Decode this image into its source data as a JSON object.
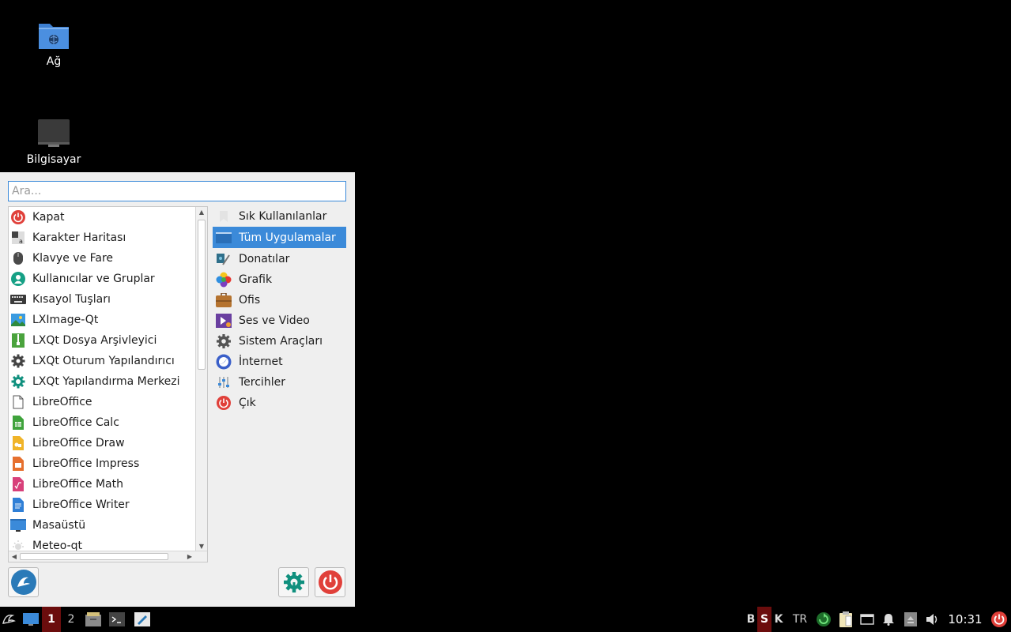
{
  "desktop": {
    "icons": [
      {
        "label": "Ağ",
        "icon": "network-folder-icon"
      },
      {
        "label": "Bilgisayar",
        "icon": "computer-icon"
      }
    ]
  },
  "menu": {
    "search_placeholder": "Ara...",
    "apps": [
      {
        "label": "Kapat",
        "icon": "power-icon"
      },
      {
        "label": "Karakter Haritası",
        "icon": "character-map-icon"
      },
      {
        "label": "Klavye ve Fare",
        "icon": "mouse-icon"
      },
      {
        "label": "Kullanıcılar ve Gruplar",
        "icon": "users-icon"
      },
      {
        "label": "Kısayol Tuşları",
        "icon": "keyboard-icon"
      },
      {
        "label": "LXImage-Qt",
        "icon": "image-viewer-icon"
      },
      {
        "label": "LXQt Dosya Arşivleyici",
        "icon": "archiver-icon"
      },
      {
        "label": "LXQt Oturum Yapılandırıcı",
        "icon": "gear-icon"
      },
      {
        "label": "LXQt Yapılandırma Merkezi",
        "icon": "config-center-icon"
      },
      {
        "label": "LibreOffice",
        "icon": "libreoffice-icon"
      },
      {
        "label": "LibreOffice Calc",
        "icon": "calc-icon"
      },
      {
        "label": "LibreOffice Draw",
        "icon": "draw-icon"
      },
      {
        "label": "LibreOffice Impress",
        "icon": "impress-icon"
      },
      {
        "label": "LibreOffice Math",
        "icon": "math-icon"
      },
      {
        "label": "LibreOffice Writer",
        "icon": "writer-icon"
      },
      {
        "label": "Masaüstü",
        "icon": "desktop-icon"
      },
      {
        "label": "Meteo-qt",
        "icon": "weather-icon"
      }
    ],
    "categories": [
      {
        "label": "Sık Kullanılanlar",
        "icon": "bookmark-icon",
        "selected": false
      },
      {
        "label": "Tüm Uygulamalar",
        "icon": "all-apps-icon",
        "selected": true
      },
      {
        "label": "Donatılar",
        "icon": "accessories-icon",
        "selected": false
      },
      {
        "label": "Grafik",
        "icon": "graphics-icon",
        "selected": false
      },
      {
        "label": "Ofis",
        "icon": "office-icon",
        "selected": false
      },
      {
        "label": "Ses ve Video",
        "icon": "multimedia-icon",
        "selected": false
      },
      {
        "label": "Sistem Araçları",
        "icon": "system-tools-icon",
        "selected": false
      },
      {
        "label": "İnternet",
        "icon": "internet-icon",
        "selected": false
      },
      {
        "label": "Tercihler",
        "icon": "preferences-icon",
        "selected": false
      },
      {
        "label": "Çık",
        "icon": "exit-icon",
        "selected": false
      }
    ],
    "bottom_buttons": [
      "lxqt-logo-icon",
      "config-center-icon",
      "power-icon"
    ]
  },
  "taskbar": {
    "workspaces": [
      "1",
      "2"
    ],
    "active_workspace": "1",
    "kbd_indicators": [
      "B",
      "S",
      "K"
    ],
    "active_kbd": "S",
    "layout": "TR",
    "clock": "10:31"
  },
  "colors": {
    "accent": "#3b8ad9",
    "menu_bg": "#efefef",
    "active_workspace": "#6b0d0d",
    "power_red": "#e0403a"
  }
}
